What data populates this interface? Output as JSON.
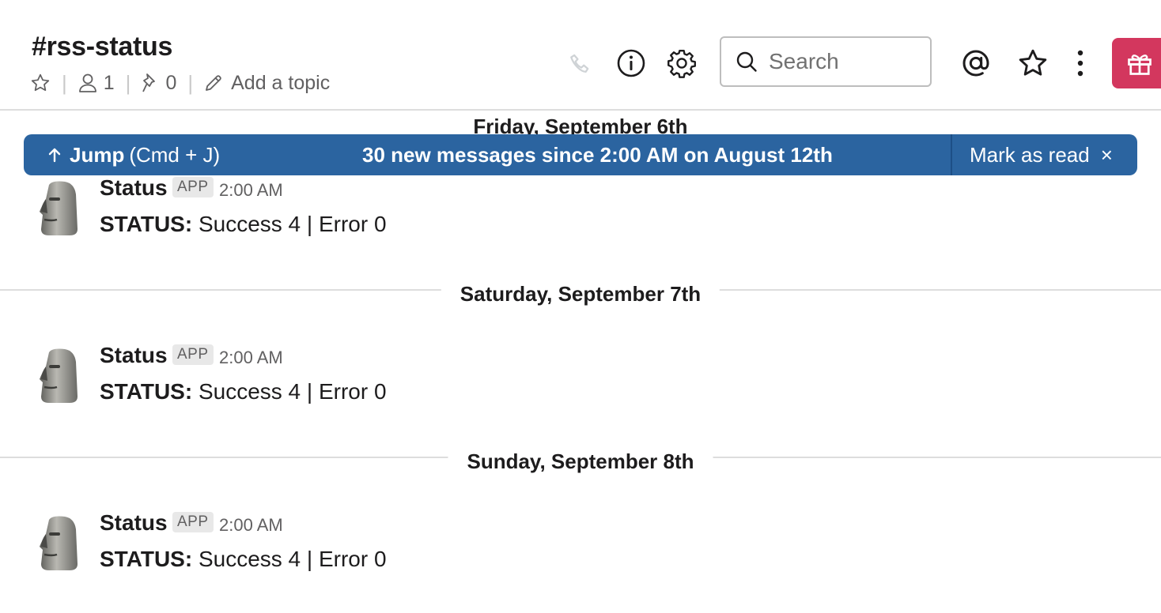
{
  "header": {
    "channel_name": "#rss-status",
    "member_count": "1",
    "pinned_count": "0",
    "add_topic_label": "Add a topic",
    "search_placeholder": "Search"
  },
  "jump_banner": {
    "jump_label": "Jump",
    "jump_hint": "(Cmd + J)",
    "new_messages_text": "30 new messages since 2:00 AM on August 12th",
    "mark_as_read_label": "Mark as read",
    "close_glyph": "×"
  },
  "days": [
    {
      "label": "Friday, September 6th"
    },
    {
      "label": "Saturday, September 7th"
    },
    {
      "label": "Sunday, September 8th"
    }
  ],
  "messages": [
    {
      "sender": "Status",
      "badge": "APP",
      "time": "2:00 AM",
      "prefix": "STATUS:",
      "text": "Success 4 | Error 0"
    },
    {
      "sender": "Status",
      "badge": "APP",
      "time": "2:00 AM",
      "prefix": "STATUS:",
      "text": "Success 4 | Error 0"
    },
    {
      "sender": "Status",
      "badge": "APP",
      "time": "2:00 AM",
      "prefix": "STATUS:",
      "text": "Success 4 | Error 0"
    }
  ],
  "colors": {
    "banner_blue": "#2b64a0",
    "gift_red": "#d3375e",
    "divider": "#dddddd"
  },
  "icons": [
    "star-icon",
    "member-icon",
    "pin-icon",
    "pencil-icon",
    "phone-icon",
    "info-icon",
    "gear-icon",
    "search-icon",
    "mention-icon",
    "star-outline-icon",
    "more-vertical-icon",
    "gift-icon",
    "arrow-up-icon",
    "moai-avatar-icon"
  ]
}
